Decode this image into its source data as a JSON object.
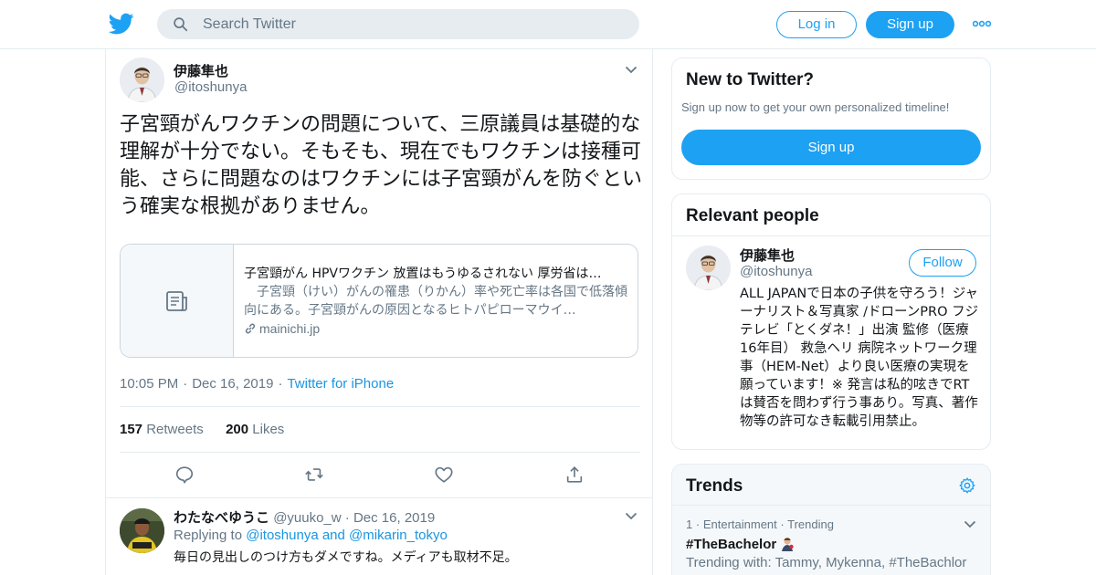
{
  "colors": {
    "accent": "#1da1f2",
    "link": "#1b95e0",
    "muted": "#657786",
    "text": "#14171a",
    "border": "#e6ecf0"
  },
  "header": {
    "logo": "twitter-bird-icon",
    "search_placeholder": "Search Twitter",
    "login_label": "Log in",
    "signup_label": "Sign up",
    "more": "more-dots-icon"
  },
  "tweet": {
    "author_name": "伊藤隼也",
    "author_handle": "@itoshunya",
    "text": "子宮頸がんワクチンの問題について、三原議員は基礎的な理解が十分でない。そもそも、現在でもワクチンは接種可能、さらに問題なのはワクチンには子宮頸がんを防ぐという確実な根拠がありません。",
    "card": {
      "title": "子宮頸がん HPVワクチン 放置はもうゆるされない 厚労省は…",
      "description": "　子宮頸（けい）がんの罹患（りかん）率や死亡率は各国で低落傾向にある。子宮頸がんの原因となるヒトパピローマウイ…",
      "domain": "mainichi.jp"
    },
    "time": "10:05 PM",
    "date": "Dec 16, 2019",
    "source": "Twitter for iPhone",
    "retweets_count": "157",
    "retweets_label": "Retweets",
    "likes_count": "200",
    "likes_label": "Likes"
  },
  "reply": {
    "author_name": "わたなべゆうこ",
    "author_handle": "@yuuko_w",
    "date": "Dec 16, 2019",
    "replying_prefix": "Replying to",
    "replying_to_1": "@itoshunya",
    "replying_and": "and",
    "replying_to_2": "@mikarin_tokyo",
    "text": "毎日の見出しのつけ方もダメですね。メディアも取材不足。"
  },
  "sidebar": {
    "new": {
      "title": "New to Twitter?",
      "subtitle": "Sign up now to get your own personalized timeline!",
      "button": "Sign up"
    },
    "relevant": {
      "title": "Relevant people",
      "name": "伊藤隼也",
      "handle": "@itoshunya",
      "follow_label": "Follow",
      "bio": "ALL JAPANで日本の子供を守ろう！ジャーナリスト＆写真家 /ドローンPRO フジテレビ「とくダネ！」出演 監修（医療 16年目） 救急ヘリ 病院ネットワーク理事（HEM-Net）より良い医療の実現を願っています！※ 発言は私的呟きでRTは賛否を問わず行う事あり。写真、著作物等の許可なき転載引用禁止。"
    },
    "trends": {
      "title": "Trends",
      "items": [
        {
          "rank": "1",
          "category": "Entertainment",
          "status": "Trending",
          "name": "#TheBachelor",
          "with_label": "Trending with:",
          "with_text": "Tammy, Mykenna, #TheBachlor"
        }
      ]
    }
  }
}
